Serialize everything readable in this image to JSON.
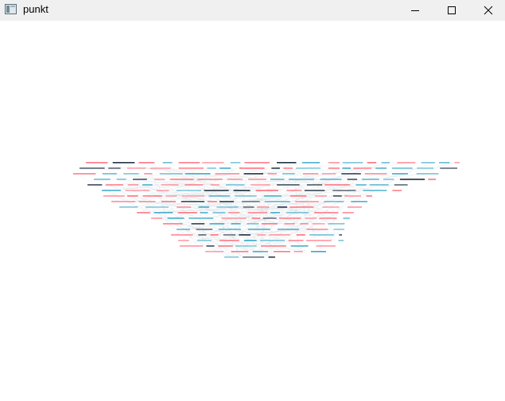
{
  "window": {
    "title": "punkt"
  },
  "title_controls": {
    "minimize_icon": "minimize-icon",
    "maximize_icon": "maximize-icon",
    "close_icon": "close-icon"
  },
  "colors": {
    "titlebar": "#f0f0f0",
    "label_red": "#ff6b7a",
    "label_blue": "#3aa6c9",
    "label_dark": "#1a2a3a",
    "edge_gray": "#c8d0d8"
  }
}
